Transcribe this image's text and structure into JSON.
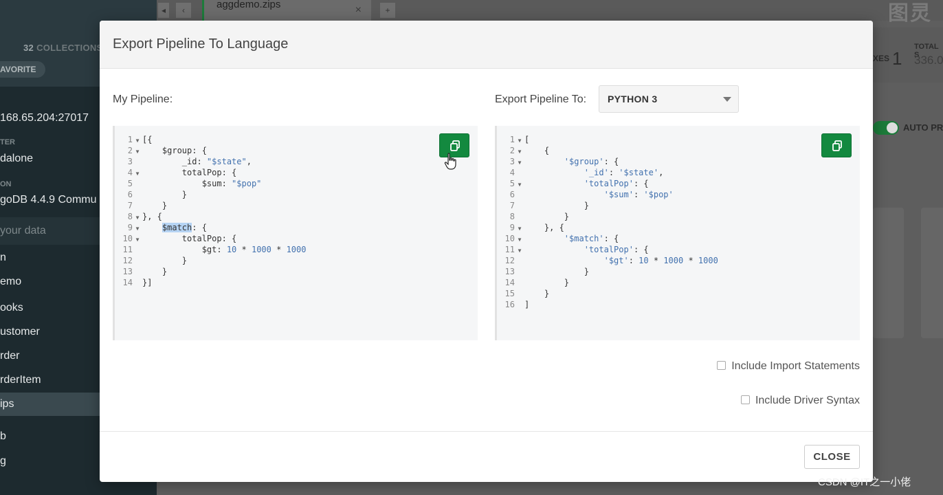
{
  "background": {
    "sidebar": {
      "collection_count": "32",
      "collection_label": "COLLECTIONS",
      "favorite_label": "AVORITE",
      "host": "168.65.204:27017",
      "cluster_label": "TER",
      "cluster_value": "dalone",
      "edition_label": "ON",
      "edition_value": "goDB 4.4.9 Commu",
      "filter_placeholder": "your data",
      "databases": [
        "n",
        "emo",
        "ooks",
        "ustomer",
        "rder",
        "rderItem",
        "ips",
        "b",
        "g"
      ],
      "active_database_index": 6
    },
    "tab": {
      "namespace": "aggdemo.zips",
      "close_glyph": "×",
      "back_glyph": "◂",
      "prev_glyph": "‹",
      "add_glyph": "+"
    },
    "brand": "图灵",
    "stats": {
      "indexes_label": "XES",
      "indexes_value": "1",
      "total_label": "TOTAL S",
      "total_value": "336.0"
    },
    "auto_preview_label": "AUTO PR"
  },
  "modal": {
    "title": "Export Pipeline To Language",
    "my_pipeline_label": "My Pipeline:",
    "export_to_label": "Export Pipeline To:",
    "language_selected": "PYTHON 3",
    "include_imports_label": "Include Import Statements",
    "include_driver_label": "Include Driver Syntax",
    "include_imports_checked": false,
    "include_driver_checked": false,
    "close_label": "CLOSE"
  },
  "watermark": "CSDN @IT之一小佬"
}
